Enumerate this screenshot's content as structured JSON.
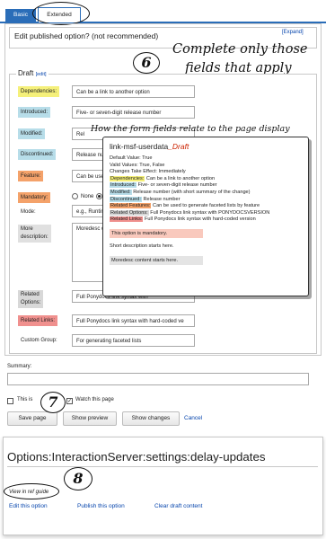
{
  "tabs": {
    "basic": "Basic",
    "extended": "Extended"
  },
  "header": {
    "title": "Edit published option? (not recommended)",
    "expand_link": "[Expand]"
  },
  "annotations": {
    "step6": "6",
    "note1_line1": "Complete only those",
    "note1_line2": "fields that apply",
    "note2": "How the form fields relate to the page display",
    "step7": "7",
    "step8": "8"
  },
  "draft": {
    "legend": "Draft",
    "edit_link": "[edit]"
  },
  "form": {
    "dependencies": {
      "label": "Dependencies:",
      "value": "Can be a link to another option"
    },
    "introduced": {
      "label": "Introduced:",
      "value": "Five- or seven-digit release number"
    },
    "modified": {
      "label": "Modified:",
      "value": "Rel"
    },
    "discontinued": {
      "label": "Discontinued:",
      "value": "Release num"
    },
    "feature": {
      "label": "Feature:",
      "value": "Can be use"
    },
    "mandatory": {
      "label": "Mandatory:",
      "opt_none": "None"
    },
    "mode": {
      "label": "Mode:",
      "value": "e.g., Runtim"
    },
    "more_description": {
      "label1": "More",
      "label2": "description:",
      "value": "Moredesc co"
    },
    "related_options": {
      "label1": "Related",
      "label2": "Options:",
      "value": "Full Ponydocs link syntax with"
    },
    "related_links": {
      "label": "Related Links:",
      "value": "Full Ponydocs link syntax with hard-coded ve"
    },
    "custom_group": {
      "label": "Custom Group:",
      "value": "For generating faceted lists"
    }
  },
  "preview": {
    "title": "link-msf-userdata",
    "draft_suffix": "_Draft",
    "default_value": "Default Value: True",
    "valid_values": "Valid Values: True, False",
    "changes": "Changes Take Effect: Immediately",
    "dep_label": "Dependencies:",
    "dep_text": "Can be a link to another option",
    "intro_label": "Introduced:",
    "intro_text": "Five- or seven-digit release number",
    "mod_label": "Modified:",
    "mod_text": "Release number (with short summary of the change)",
    "disc_label": "Discontinued:",
    "disc_text": "Release number",
    "feat_label": "Related Features:",
    "feat_text": "Can be used to generate faceted lists by feature",
    "ropt_label": "Related Options:",
    "ropt_text": "Full Ponydocs link syntax with PONYDOCSVERSION",
    "rlink_label": "Related Links:",
    "rlink_text": "Full Ponydocs link syntax with hard-coded version",
    "mandatory_note": "This option is mandatory.",
    "short_desc": "Short description starts here.",
    "more_desc": "Moredesc content starts here."
  },
  "summary": {
    "label": "Summary:"
  },
  "checkboxes": {
    "minor": "This is",
    "watch": "Watch this page"
  },
  "buttons": {
    "save": "Save page",
    "preview": "Show preview",
    "changes": "Show changes",
    "cancel": "Cancel"
  },
  "page": {
    "title": "Options:InteractionServer:settings:delay-updates",
    "view_ref": "View in ref guide"
  },
  "actions": {
    "edit": "Edit this option",
    "publish": "Publish this option",
    "clear": "Clear draft content"
  },
  "colors": {
    "dependencies": "#f5f07a",
    "introduced": "#b7dde9",
    "modified": "#b7dde9",
    "discontinued": "#b7dde9",
    "feature": "#f4a26a",
    "related_links": "#f0908e",
    "related_options": "#d8d8d8",
    "draft_red": "#cc2200"
  }
}
